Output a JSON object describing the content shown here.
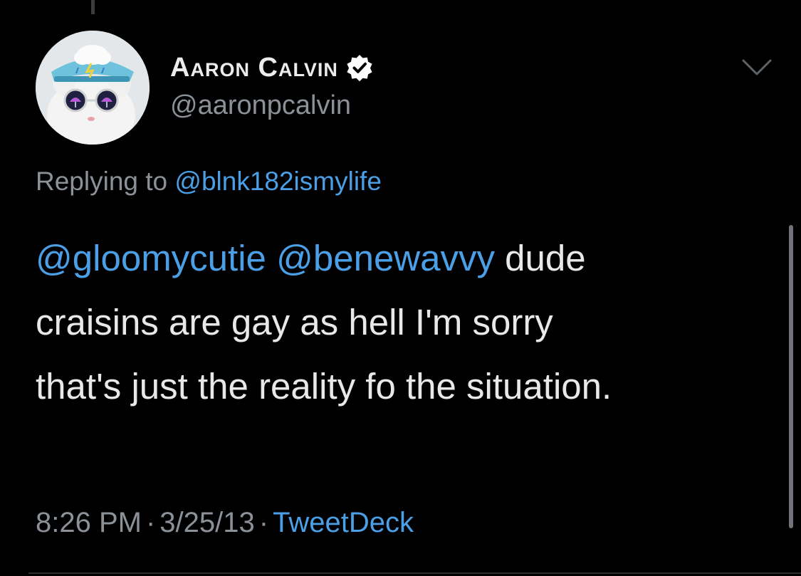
{
  "tweet": {
    "author": {
      "display_name": "Aaron Calvin",
      "handle": "@aaronpcalvin",
      "verified": true,
      "avatar_icon": "cat-with-rain-cloud-hat-avatar"
    },
    "reply_to": {
      "prefix": "Replying to",
      "handle": "@blnk182ismylife"
    },
    "text": {
      "line1_mention1": "@gloomycutie",
      "line1_mention2": "@benewavvy",
      "line1_rest": " dude",
      "line2": "craisins are gay as hell I'm sorry",
      "line3": "that's just the reality fo the situation."
    },
    "meta": {
      "time": "8:26 PM",
      "separator": "·",
      "date": "3/25/13",
      "source": "TweetDeck"
    },
    "menu_icon": "chevron-down-icon"
  },
  "colors": {
    "background": "#000000",
    "text": "#e8e8e8",
    "secondary_text": "#8b9197",
    "link": "#4a9fe6",
    "verified_badge": "#ffffff"
  }
}
